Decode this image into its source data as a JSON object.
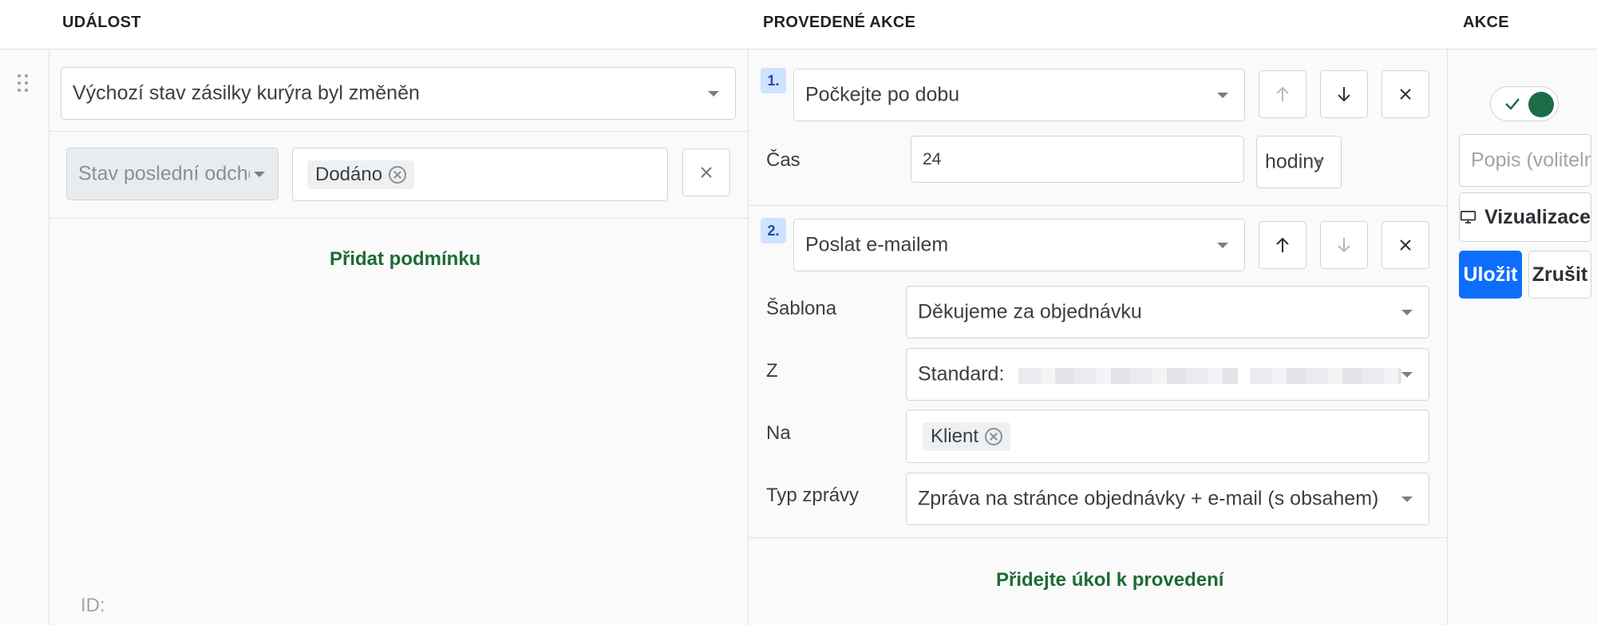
{
  "header": {
    "col_event": "UDÁLOST",
    "col_actions_done": "PROVEDENÉ AKCE",
    "col_actions": "AKCE"
  },
  "event": {
    "selected": "Výchozí stav zásilky kurýra byl změněn",
    "condition": {
      "field": "Stav poslední odchozí",
      "value_tag": "Dodáno"
    },
    "add_condition": "Přidat podmínku",
    "id_label": "ID:"
  },
  "actions": [
    {
      "number": "1.",
      "type": "Počkejte po dobu",
      "params": {
        "time_label": "Čas",
        "time_value": "24",
        "unit": "hodiny"
      }
    },
    {
      "number": "2.",
      "type": "Poslat e-mailem",
      "params": {
        "template_label": "Šablona",
        "template_value": "Děkujeme za objednávku",
        "from_label": "Z",
        "from_value": "Standard:",
        "to_label": "Na",
        "to_tag": "Klient",
        "msgtype_label": "Typ zprávy",
        "msgtype_value": "Zpráva na stránce objednávky + e-mail (s obsahem)"
      }
    }
  ],
  "add_action": "Přidejte úkol k provedení",
  "sidebar": {
    "description_placeholder": "Popis (volitelné)",
    "visualize_label": "Vizualizace",
    "save_label": "Uložit",
    "cancel_label": "Zrušit"
  },
  "colors": {
    "primary": "#0d6efd",
    "link_green": "#1e6b35",
    "toggle_on": "#1e6b4a",
    "badge_bg": "#cfe2ff"
  }
}
